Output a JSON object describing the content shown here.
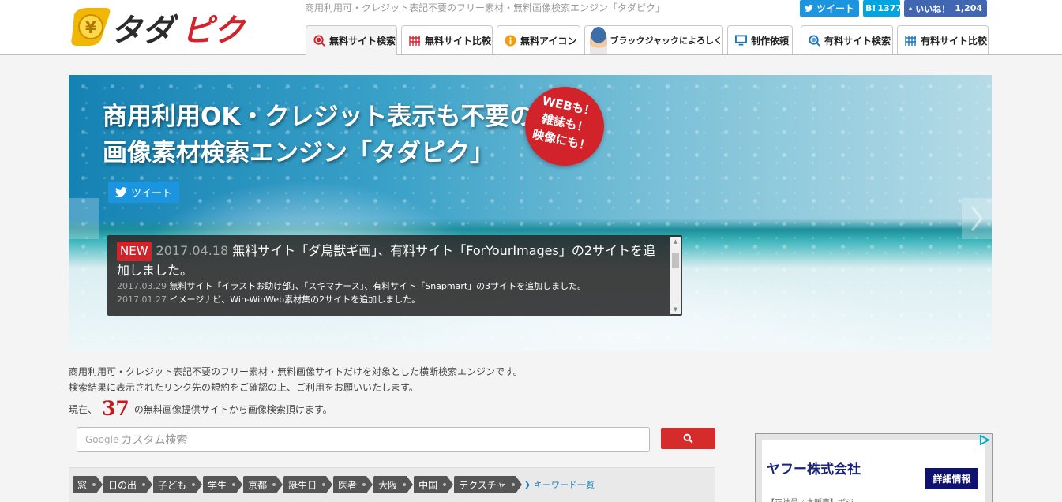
{
  "header": {
    "logo_text": "タダピク",
    "tagline": "商用利用可・クレジット表記不要のフリー素材・無料画像検索エンジン「タダピク」",
    "social": {
      "tweet_label": "ツイート",
      "hatena_label": "B!",
      "hatena_count": "1377",
      "like_label": "いいね！",
      "like_count": "1,204"
    },
    "tabs": [
      {
        "label": "無料サイト検索",
        "icon": "search-icon",
        "active": true
      },
      {
        "label": "無料サイト比較",
        "icon": "grid-icon"
      },
      {
        "label": "無料アイコン",
        "icon": "info-icon"
      },
      {
        "label": "ブラックジャックによろしく",
        "icon": "avatar-icon"
      },
      {
        "label": "制作依頼",
        "icon": "monitor-icon"
      },
      {
        "label": "有料サイト検索",
        "icon": "search-icon"
      },
      {
        "label": "有料サイト比較",
        "icon": "grid-icon"
      }
    ]
  },
  "hero": {
    "title_line1": "商用利用OK・クレジット表示も不要の",
    "title_line2": "画像素材検索エンジン「タダピク」",
    "badge_lines": [
      "WEBも！",
      "雑誌も！",
      "映像にも！"
    ],
    "tweet_label": "ツイート",
    "news": {
      "new_tag": "NEW",
      "items": [
        {
          "date": "2017.04.18",
          "text": "無料サイト「ダ鳥獣ギ画」、有料サイト「ForYourImages」の2サイトを追加しました。"
        },
        {
          "date": "2017.03.29",
          "text": "無料サイト「イラストお助け部」、「スキマナース」、有料サイト「Snapmart」の3サイトを追加しました。"
        },
        {
          "date": "2017.01.27",
          "text": "イメージナビ、Win-WinWeb素材集の2サイトを追加しました。"
        }
      ]
    }
  },
  "intro": {
    "line1": "商用利用可・クレジット表記不要のフリー素材・無料画像サイトだけを対象とした横断検索エンジンです。",
    "line2": "検索結果に表示されたリンク先の規約をご確認の上、ご利用をお願いいたします。",
    "count_prefix": "現在、",
    "count": "37",
    "count_suffix": "の無料画像提供サイトから画像検索頂けます。"
  },
  "search": {
    "placeholder_brand": "Google",
    "placeholder": "カスタム検索",
    "button_icon": "search-icon"
  },
  "keywords": {
    "items": [
      "窓",
      "日の出",
      "子ども",
      "学生",
      "京都",
      "誕生日",
      "医者",
      "大阪",
      "中国",
      "テクスチャ"
    ],
    "all_link": "キーワード一覧"
  },
  "ad": {
    "company": "ヤフー株式会社",
    "button": "詳細情報",
    "sub": "【正社員／本販売】ボジ…",
    "colors": {
      "button": "#10136e",
      "company": "#1a237e"
    }
  },
  "colors": {
    "accent_red": "#d3232a",
    "twitter": "#1b95e0",
    "hatena": "#00a4de",
    "facebook": "#4267b2"
  }
}
